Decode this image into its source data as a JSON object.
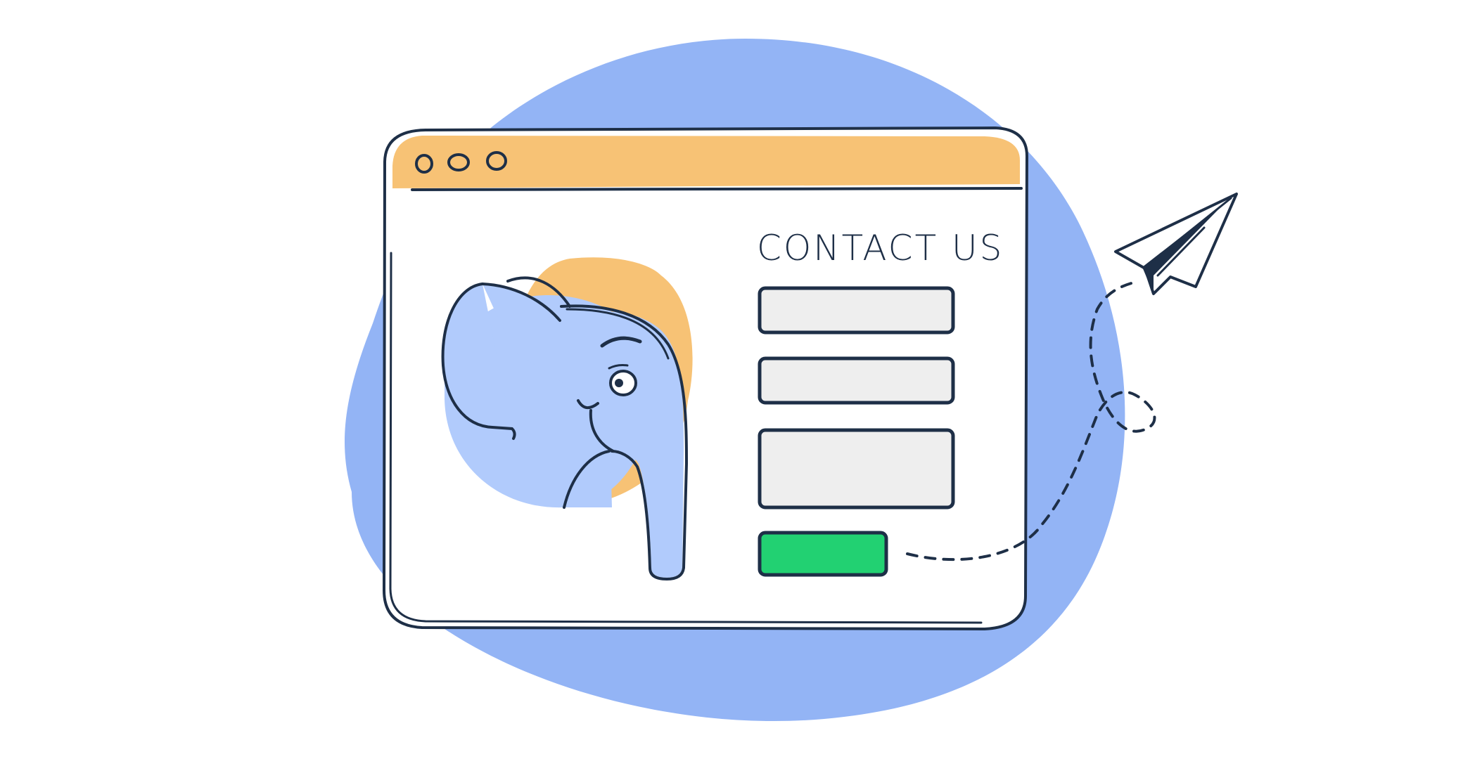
{
  "contact": {
    "title": "CONTACT US"
  },
  "colors": {
    "background": "#ffffff",
    "blob": "#93b4f5",
    "title_bar": "#f7c275",
    "window_fill": "#ffffff",
    "outline": "#1e2f47",
    "field_fill": "#eeeeee",
    "submit_fill": "#22d172",
    "elephant": "#b1cbfc",
    "elephant_backdrop": "#f7c275",
    "paper_plane": "#ffffff"
  },
  "icons": {
    "window_controls": [
      "window-control-dot",
      "window-control-dot",
      "window-control-dot"
    ],
    "illustration": "elephant-illustration",
    "plane": "paper-plane-icon"
  },
  "form": {
    "fields": [
      "name-field",
      "email-field",
      "message-field"
    ],
    "submit": "send-button"
  }
}
